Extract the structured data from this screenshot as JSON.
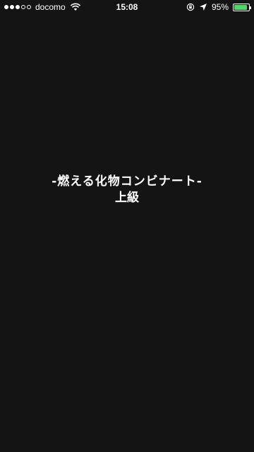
{
  "status_bar": {
    "signal_filled": 3,
    "signal_total": 5,
    "carrier": "docomo",
    "time": "15:08",
    "battery_percent": "95%",
    "battery_level": 0.95,
    "battery_color": "#4cd964",
    "icons": [
      "signal-dots-icon",
      "wifi-icon",
      "rotation-lock-icon",
      "location-arrow-icon",
      "battery-icon"
    ]
  },
  "screen": {
    "background": "#141414",
    "stage_title": "-燃える化物コンビナート-",
    "difficulty": "上級"
  }
}
